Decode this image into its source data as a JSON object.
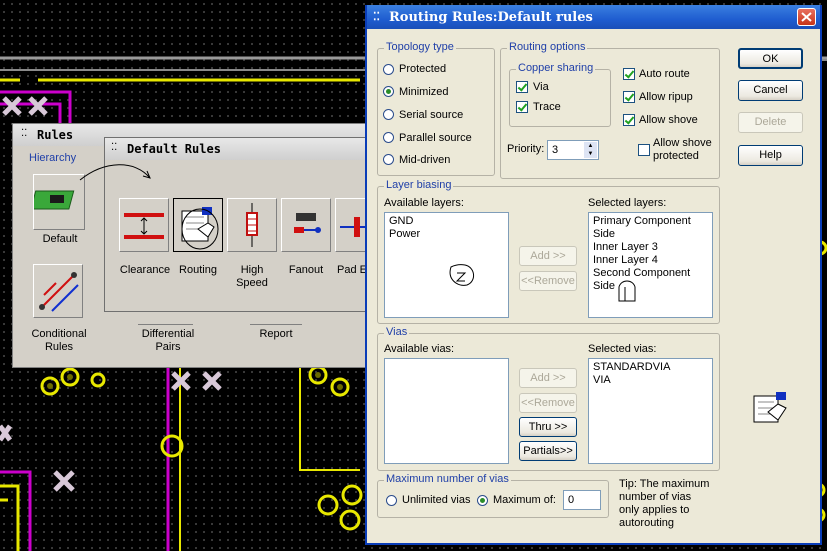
{
  "colors": {
    "pcb_background": "#000000",
    "trace_magenta": "#cc00cc",
    "trace_yellow": "#f0f000",
    "title_blue": "#1f5dd0"
  },
  "rules_window": {
    "title": "Rules",
    "hierarchy_label": "Hierarchy",
    "items": [
      {
        "label": "Default",
        "icon": "board-icon"
      },
      {
        "label": "Conditional\nRules",
        "icon": "conditional-rules-icon"
      },
      {
        "label": "Differential\nPairs",
        "icon": "differential-pairs-icon"
      },
      {
        "label": "Report",
        "icon": "report-icon"
      }
    ]
  },
  "default_rules_window": {
    "title": "Default Rules",
    "items": [
      {
        "label": "Clearance",
        "icon": "clearance-icon"
      },
      {
        "label": "Routing",
        "icon": "routing-icon"
      },
      {
        "label": "High\nSpeed",
        "icon": "high-speed-icon"
      },
      {
        "label": "Fanout",
        "icon": "fanout-icon"
      },
      {
        "label": "Pad E",
        "icon": "pad-entry-icon"
      }
    ]
  },
  "dialog": {
    "title": "Routing Rules:Default rules",
    "topology": {
      "label": "Topology type",
      "options": [
        "Protected",
        "Minimized",
        "Serial source",
        "Parallel source",
        "Mid-driven"
      ],
      "selected": "Minimized"
    },
    "routing_options": {
      "label": "Routing options",
      "copper_sharing": {
        "label": "Copper sharing",
        "via": "Via",
        "trace": "Trace",
        "via_checked": true,
        "trace_checked": true
      },
      "auto_route": "Auto route",
      "allow_ripup": "Allow ripup",
      "allow_shove": "Allow shove",
      "allow_shove_protected": "Allow shove protected",
      "checked": {
        "auto_route": true,
        "allow_ripup": true,
        "allow_shove": true,
        "allow_shove_protected": false
      },
      "priority_label": "Priority:",
      "priority_value": "3"
    },
    "buttons": {
      "ok": "OK",
      "cancel": "Cancel",
      "delete": "Delete",
      "help": "Help"
    },
    "layer_biasing": {
      "label": "Layer biasing",
      "available_label": "Available layers:",
      "available": [
        "GND",
        "Power"
      ],
      "selected_label": "Selected layers:",
      "selected": [
        "Primary Component Side",
        "Inner Layer 3",
        "Inner Layer 4",
        "Second Component Side"
      ],
      "add": "Add >>",
      "remove": "<<Remove"
    },
    "vias": {
      "label": "Vias",
      "available_label": "Available vias:",
      "available": [],
      "selected_label": "Selected vias:",
      "selected": [
        "STANDARDVIA",
        "VIA"
      ],
      "add": "Add >>",
      "remove": "<<Remove",
      "thru": "Thru >>",
      "partials": "Partials>>"
    },
    "max_vias": {
      "label": "Maximum number of vias",
      "unlimited": "Unlimited vias",
      "maximum_of": "Maximum of:",
      "selected": "Maximum of:",
      "value": "0"
    },
    "tip": "Tip: The maximum number of vias only applies to autorouting"
  }
}
